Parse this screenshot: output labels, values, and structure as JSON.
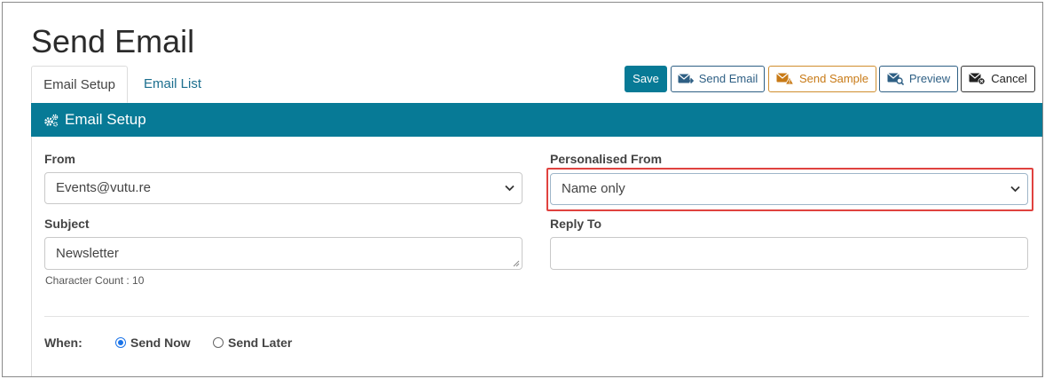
{
  "page": {
    "title": "Send Email"
  },
  "tabs": [
    {
      "label": "Email Setup",
      "active": true
    },
    {
      "label": "Email List",
      "active": false
    }
  ],
  "toolbar": {
    "save_label": "Save",
    "send_email_label": "Send Email",
    "send_sample_label": "Send Sample",
    "preview_label": "Preview",
    "cancel_label": "Cancel"
  },
  "section": {
    "title": "Email Setup",
    "icon": "gears-icon"
  },
  "form": {
    "from": {
      "label": "From",
      "value": "Events@vutu.re"
    },
    "personalised_from": {
      "label": "Personalised From",
      "value": "Name only"
    },
    "subject": {
      "label": "Subject",
      "value": "Newsletter",
      "char_count": "Character Count : 10"
    },
    "reply_to": {
      "label": "Reply To",
      "value": ""
    },
    "when": {
      "label": "When:",
      "options": [
        {
          "label": "Send Now",
          "checked": true
        },
        {
          "label": "Send Later",
          "checked": false
        }
      ]
    }
  },
  "colors": {
    "primary": "#077a96",
    "link": "#1b6e8e",
    "warning": "#c87a16",
    "highlight": "#e0423f"
  }
}
